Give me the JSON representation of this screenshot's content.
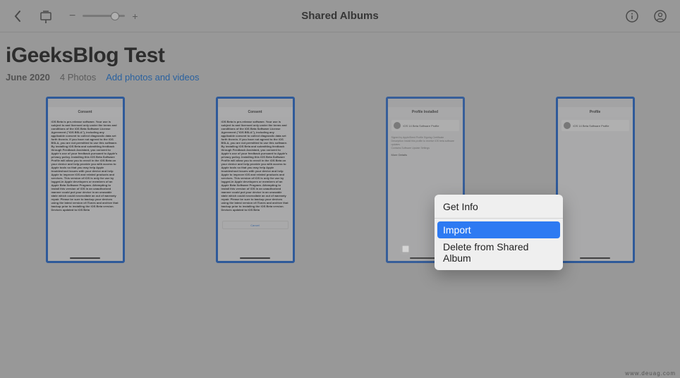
{
  "toolbar": {
    "title": "Shared Albums",
    "zoom_minus": "−",
    "zoom_plus": "+"
  },
  "album": {
    "title": "iGeeksBlog Test",
    "date": "June 2020",
    "count": "4 Photos",
    "add_label": "Add photos and videos"
  },
  "thumbs": {
    "nav_center_consent": "Consent",
    "nav_center_profile": "Profile Installed",
    "nav_center_profile2": "Profile",
    "consent_title": "iOS Beta is pre-release software. Your use is subject to and licensed only under the terms and conditions of the iOS Beta Software License Agreement (\"iOS BSLA\"), including any applicable consent to collect diagnostic data set forth therein. If you have not agreed to the iOS BSLA, you are not permitted to use this software. By installing iOS Beta and submitting feedback through Feedback Assistant, you consent to Apple's use of your feedback pursuant to Apple's privacy policy. Installing this iOS Beta Software Profile will allow you to enroll in the iOS Beta on your device and help provide you with access to Apple tools so that you may help Apple troubleshoot issues with your device and help Apple to improve iOS and related products and services. This version of iOS is only for use by logged-in Apple developers or members of an Apple Beta Software Program. Attempting to install this version of iOS in an unauthorized manner could put your device in an unusable state which could necessitate an out of warranty repair. Please be sure to backup your devices using the latest version of iTunes and archive that backup prior to installing the iOS Beta version. Devices updated to iOS Beta",
    "profile_name": "iOS 14 Beta Software Profile",
    "cancel": "Cancel"
  },
  "context_menu": {
    "items": [
      {
        "label": "Get Info",
        "selected": false
      },
      {
        "label": "Import",
        "selected": true
      },
      {
        "label": "Delete from Shared Album",
        "selected": false
      }
    ]
  },
  "watermark": "www.deuag.com"
}
